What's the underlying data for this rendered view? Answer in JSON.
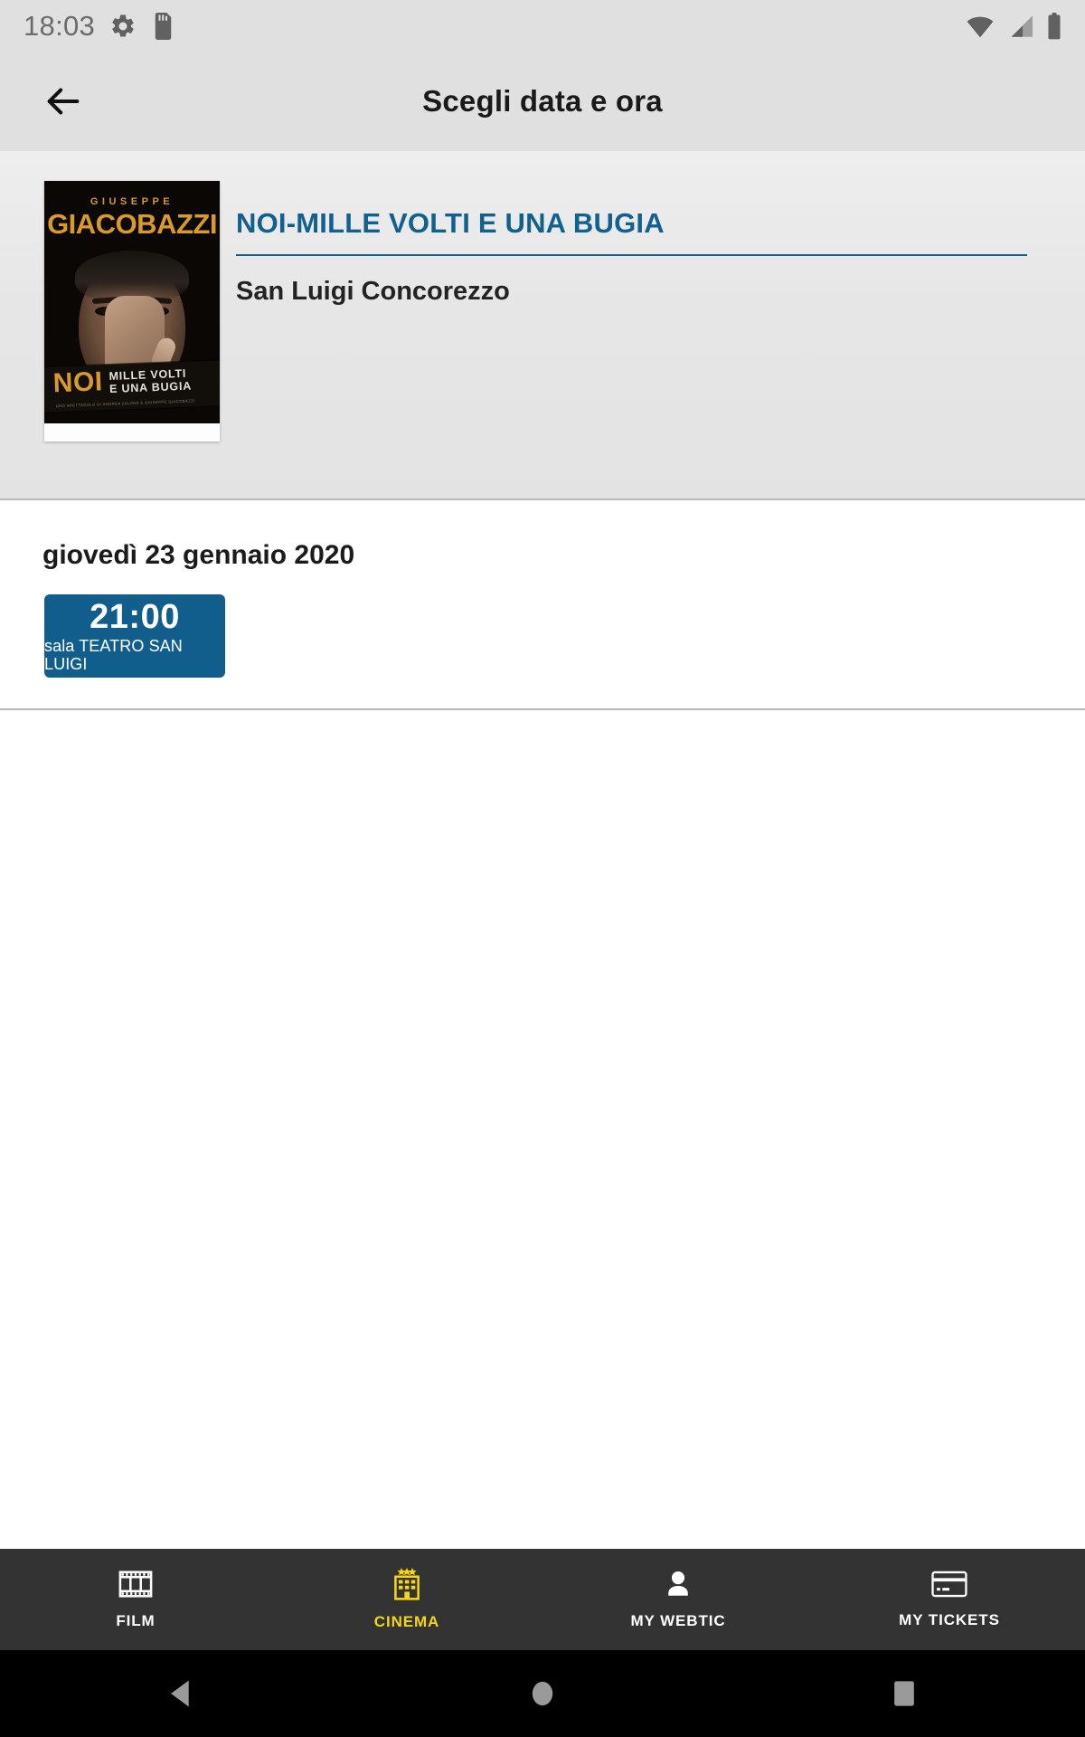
{
  "statusbar": {
    "time": "18:03",
    "icons_left": [
      "gear-icon",
      "sd-card-icon"
    ],
    "icons_right": [
      "wifi-icon",
      "cellular-signal-icon",
      "battery-icon"
    ]
  },
  "header": {
    "title": "Scegli data e ora",
    "back_icon": "arrow-left-icon"
  },
  "movie": {
    "poster": {
      "artist_small": "GIUSEPPE",
      "artist_big": "GIACOBAZZI",
      "banner_main": "NOI",
      "banner_line1": "MILLE  VOLTI",
      "banner_line2": "E UNA BUGIA",
      "banner_fineprint": "UNO SPETTACOLO DI ANDREA ZALONE E GIUSEPPE GIACOBAZZI"
    },
    "title": "NOI-MILLE VOLTI E UNA BUGIA",
    "venue": "San Luigi Concorezzo"
  },
  "schedule": {
    "days": [
      {
        "date_label": "giovedì 23 gennaio 2020",
        "showtimes": [
          {
            "time": "21:00",
            "hall": "sala TEATRO SAN LUIGI"
          }
        ]
      }
    ]
  },
  "tabbar": {
    "items": [
      {
        "label": "FILM",
        "icon": "film-strip-icon",
        "active": false
      },
      {
        "label": "CINEMA",
        "icon": "cinema-building-icon",
        "active": true
      },
      {
        "label": "MY WEBTIC",
        "icon": "person-icon",
        "active": false
      },
      {
        "label": "MY TICKETS",
        "icon": "credit-card-icon",
        "active": false
      }
    ]
  },
  "navbar": {
    "back": "triangle-back-icon",
    "home": "circle-home-icon",
    "recents": "square-recents-icon"
  },
  "colors": {
    "accent_blue": "#115e8d",
    "title_blue": "#11618f",
    "tab_active_yellow": "#f5d515",
    "tabbar_bg": "#333333",
    "header_bg": "#e0e0e0",
    "poster_gold": "#d99a28"
  }
}
